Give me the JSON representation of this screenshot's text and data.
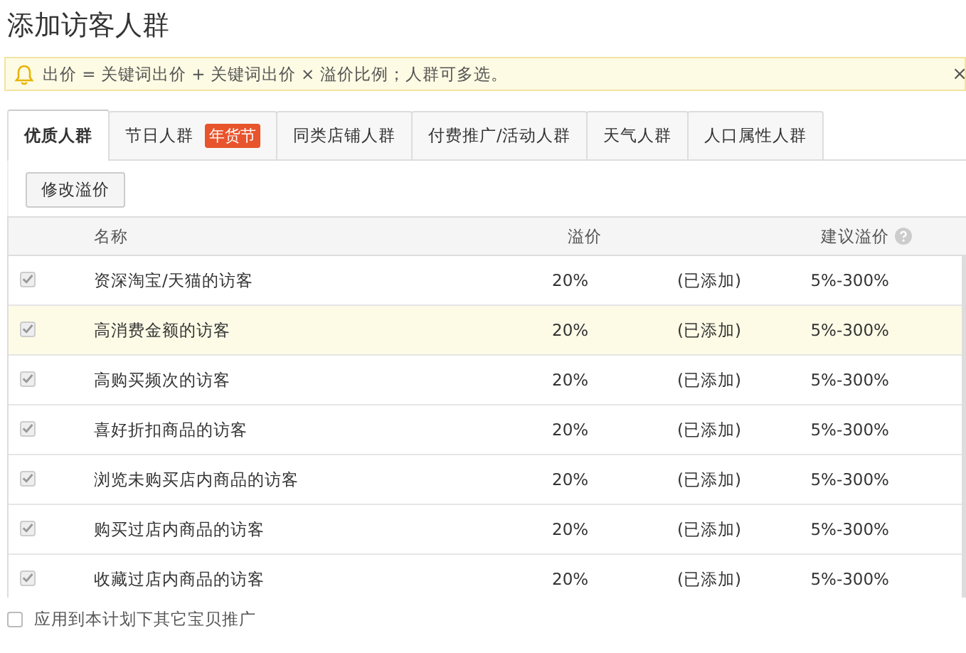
{
  "title": "添加访客人群",
  "notice": {
    "text": "出价 = 关键词出价 + 关键词出价 × 溢价比例；人群可多选。",
    "close": "×"
  },
  "tabs": [
    {
      "label": "优质人群",
      "selected": true
    },
    {
      "label": "节日人群",
      "badge": "年货节",
      "selected": false
    },
    {
      "label": "同类店铺人群",
      "selected": false
    },
    {
      "label": "付费推广/活动人群",
      "selected": false
    },
    {
      "label": "天气人群",
      "selected": false
    },
    {
      "label": "人口属性人群",
      "selected": false
    }
  ],
  "edit_button": "修改溢价",
  "table": {
    "columns": [
      "名称",
      "溢价",
      "建议溢价"
    ],
    "rows": [
      {
        "checked": true,
        "disabled": true,
        "highlighted": false,
        "name": "资深淘宝/天猫的访客",
        "premium": "20%",
        "status": "(已添加)",
        "suggested": "5%-300%"
      },
      {
        "checked": true,
        "disabled": true,
        "highlighted": true,
        "name": "高消费金额的访客",
        "premium": "20%",
        "status": "(已添加)",
        "suggested": "5%-300%"
      },
      {
        "checked": true,
        "disabled": true,
        "highlighted": false,
        "name": "高购买频次的访客",
        "premium": "20%",
        "status": "(已添加)",
        "suggested": "5%-300%"
      },
      {
        "checked": true,
        "disabled": true,
        "highlighted": false,
        "name": "喜好折扣商品的访客",
        "premium": "20%",
        "status": "(已添加)",
        "suggested": "5%-300%"
      },
      {
        "checked": true,
        "disabled": true,
        "highlighted": false,
        "name": "浏览未购买店内商品的访客",
        "premium": "20%",
        "status": "(已添加)",
        "suggested": "5%-300%"
      },
      {
        "checked": true,
        "disabled": true,
        "highlighted": false,
        "name": "购买过店内商品的访客",
        "premium": "20%",
        "status": "(已添加)",
        "suggested": "5%-300%"
      },
      {
        "checked": true,
        "disabled": true,
        "highlighted": false,
        "name": "收藏过店内商品的访客",
        "premium": "20%",
        "status": "(已添加)",
        "suggested": "5%-300%"
      }
    ]
  },
  "apply_option": {
    "label": "应用到本计划下其它宝贝推广",
    "checked": false
  }
}
